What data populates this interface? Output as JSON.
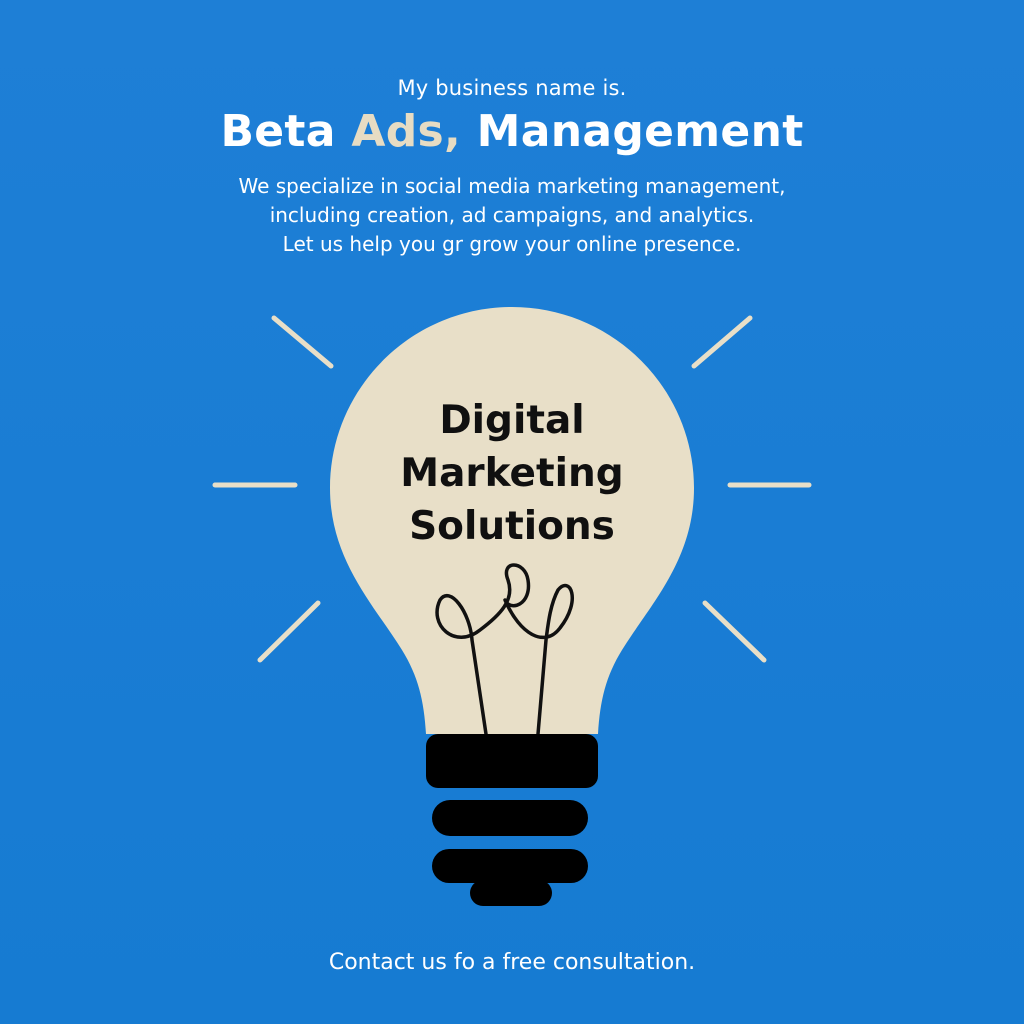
{
  "header": {
    "intro": "My business name is.",
    "title_part1": "Beta ",
    "title_accent": "Ads,",
    "title_part2": " Management",
    "description_lines": [
      "We specialize in social media marketing management,",
      "including creation, ad campaigns, and analytics.",
      "Let us help you gr grow your online presence."
    ]
  },
  "bulb": {
    "icon": "lightbulb-icon",
    "text_lines": [
      "Digital",
      "Marketing",
      "Solutions"
    ]
  },
  "footer": {
    "contact": "Contact us fo a free consultation."
  },
  "colors": {
    "background": "#1e7fd6",
    "bulb_glass": "#e8dfc8",
    "accent": "#e7dcc3",
    "bulb_base": "#000000"
  }
}
